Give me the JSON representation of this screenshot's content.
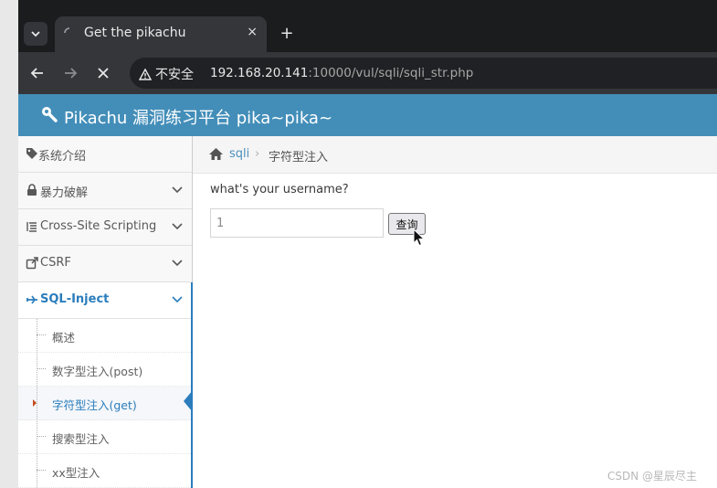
{
  "browser": {
    "tab": {
      "title": "Get the pikachu",
      "close_glyph": "×"
    },
    "new_tab_glyph": "+",
    "security_label": "不安全",
    "url": {
      "host": "192.168.20.141",
      "rest": ":10000/vul/sqli/sqli_str.php"
    }
  },
  "site": {
    "title": "Pikachu 漏洞练习平台 pika~pika~"
  },
  "sidebar": {
    "items": [
      {
        "label": "系统介绍",
        "icon": "tags-icon"
      },
      {
        "label": "暴力破解",
        "icon": "lock-icon"
      },
      {
        "label": "Cross-Site Scripting",
        "icon": "list-icon"
      },
      {
        "label": "CSRF",
        "icon": "external-link-icon"
      },
      {
        "label": "SQL-Inject",
        "icon": "plane-icon"
      }
    ],
    "sub_items": [
      {
        "label": "概述"
      },
      {
        "label": "数字型注入(post)"
      },
      {
        "label": "字符型注入(get)"
      },
      {
        "label": "搜索型注入"
      },
      {
        "label": "xx型注入"
      }
    ]
  },
  "breadcrumb": {
    "link": "sqli",
    "separator": "›",
    "current": "字符型注入"
  },
  "form": {
    "prompt": "what's your username?",
    "input_value": "1",
    "submit_label": "查询"
  },
  "watermark": "CSDN @星辰尽主",
  "colors": {
    "header": "#438eb9",
    "accent": "#2b7dbc",
    "tab_bg": "#35363a",
    "strip_bg": "#1b1c1e"
  }
}
